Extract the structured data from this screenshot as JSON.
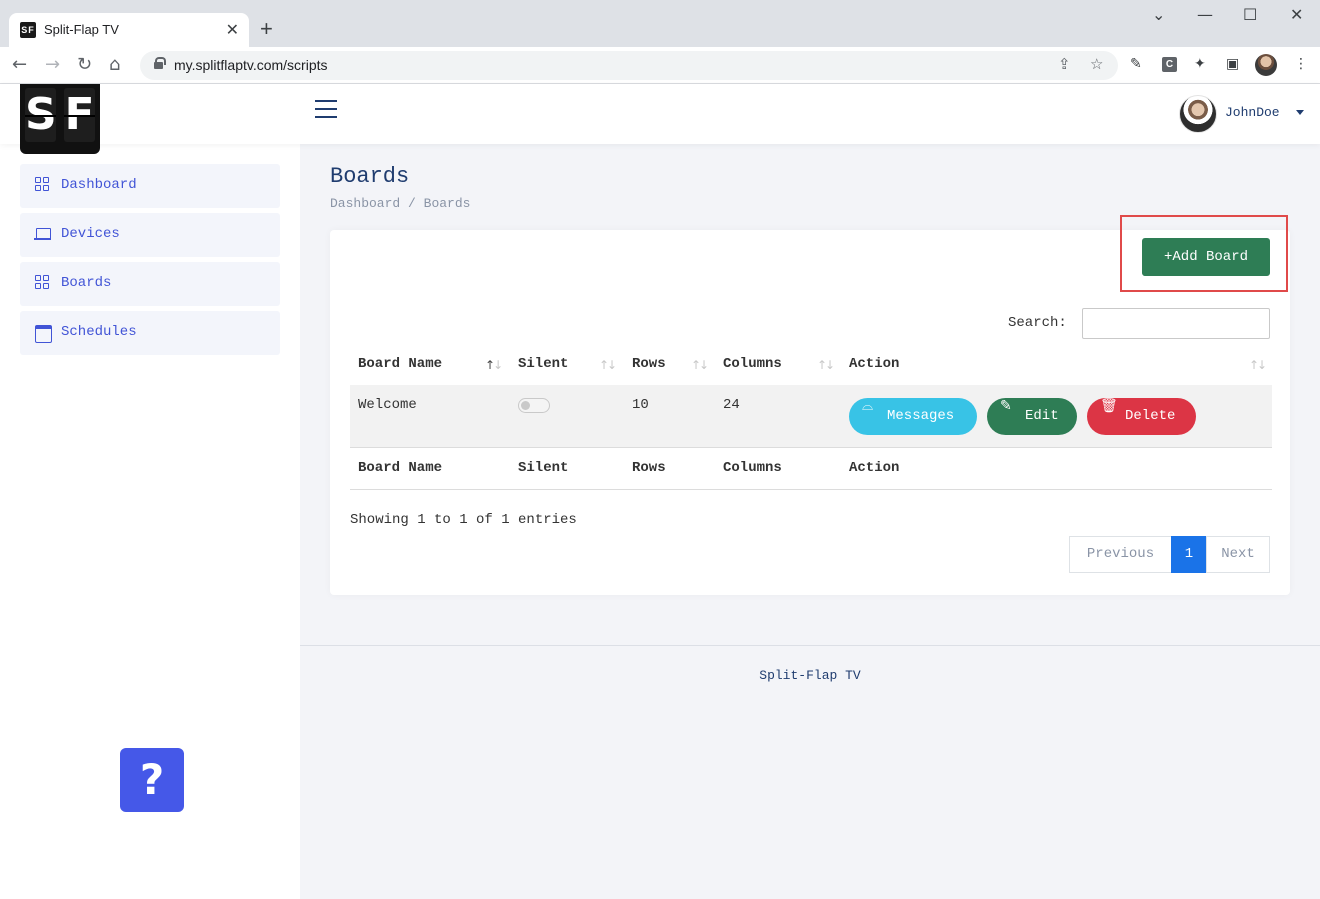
{
  "browser": {
    "tab_title": "Split-Flap TV",
    "favicon_text": "SF",
    "tab_close": "✕",
    "new_tab": "+",
    "url": "my.splitflaptv.com/scripts"
  },
  "topbar": {
    "logo_letters": [
      "S",
      "F"
    ],
    "user_name": "JohnDoe"
  },
  "sidebar": {
    "items": [
      {
        "label": "Dashboard",
        "icon": "grid-icon"
      },
      {
        "label": "Devices",
        "icon": "laptop-icon"
      },
      {
        "label": "Boards",
        "icon": "grid-icon"
      },
      {
        "label": "Schedules",
        "icon": "calendar-icon"
      }
    ],
    "help_label": "?"
  },
  "page": {
    "title": "Boards",
    "breadcrumb": [
      "Dashboard",
      "Boards"
    ],
    "breadcrumb_sep": "/"
  },
  "card": {
    "add_button": "+Add Board",
    "search_label": "Search:",
    "search_value": "",
    "columns": [
      "Board Name",
      "Silent",
      "Rows",
      "Columns",
      "Action"
    ],
    "rows": [
      {
        "name": "Welcome",
        "silent": false,
        "rows": "10",
        "columns": "24"
      }
    ],
    "actions": {
      "messages": "Messages",
      "edit": "Edit",
      "delete": "Delete"
    },
    "showing": "Showing 1 to 1 of 1 entries",
    "pagination": {
      "previous": "Previous",
      "current": "1",
      "next": "Next"
    }
  },
  "footer": {
    "text": "Split-Flap TV"
  },
  "colors": {
    "add_button": "#2e7d55",
    "messages": "#38c3e6",
    "edit": "#2e7d55",
    "delete": "#dc3545",
    "page_active": "#1a73e8",
    "accent": "#4154d6",
    "help": "#4558e8"
  }
}
